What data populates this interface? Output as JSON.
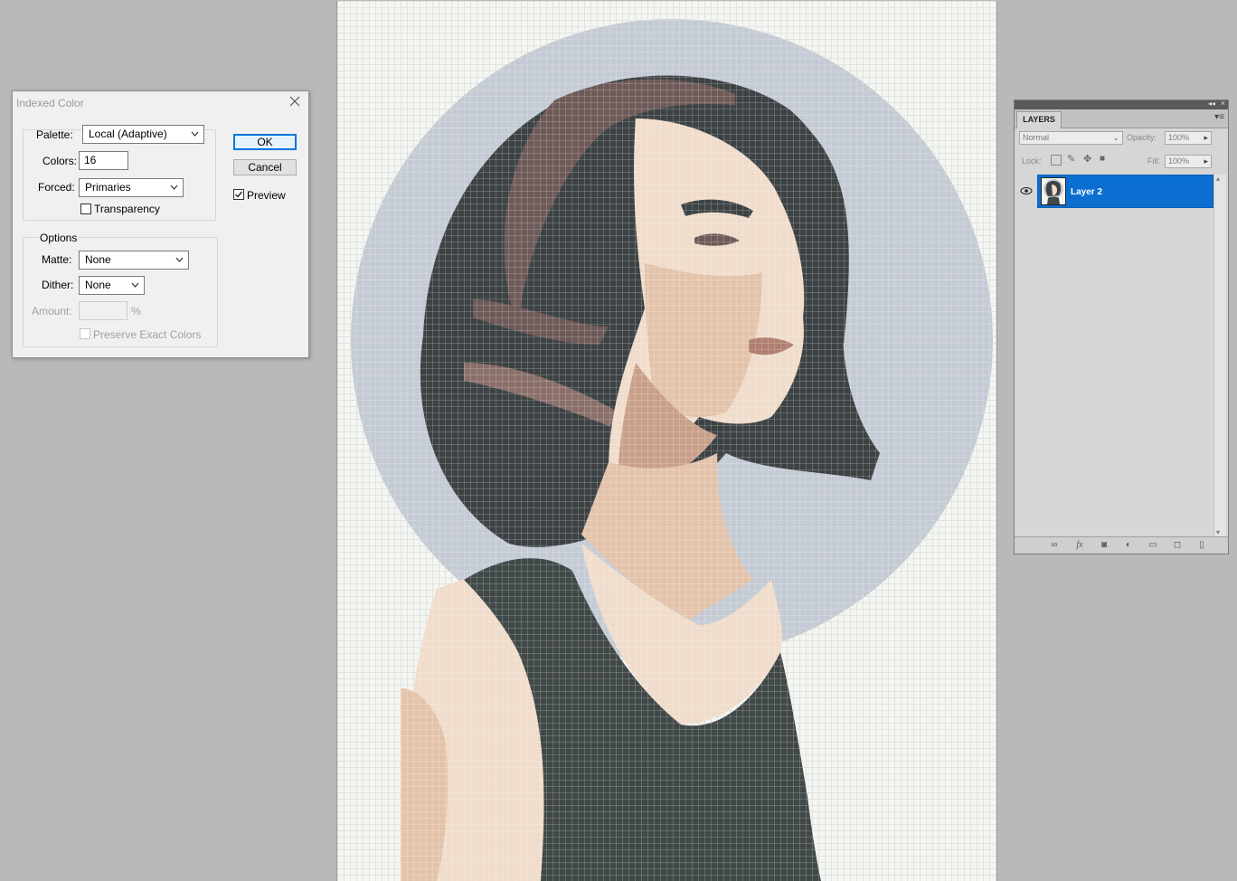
{
  "dialog": {
    "title": "Indexed Color",
    "palette_label": "Palette:",
    "palette_value": "Local (Adaptive)",
    "colors_label": "Colors:",
    "colors_value": "16",
    "forced_label": "Forced:",
    "forced_value": "Primaries",
    "transparency_label": "Transparency",
    "transparency_checked": false,
    "options_legend": "Options",
    "matte_label": "Matte:",
    "matte_value": "None",
    "dither_label": "Dither:",
    "dither_value": "None",
    "amount_label": "Amount:",
    "amount_value": "",
    "amount_unit": "%",
    "preserve_label": "Preserve Exact Colors",
    "preserve_checked": false,
    "ok_label": "OK",
    "cancel_label": "Cancel",
    "preview_label": "Preview",
    "preview_checked": true
  },
  "layers_panel": {
    "tab_label": "LAYERS",
    "blend_mode": "Normal",
    "opacity_label": "Opacity:",
    "opacity_value": "100%",
    "lock_label": "Lock:",
    "fill_label": "Fill:",
    "fill_value": "100%",
    "layers": [
      {
        "name": "Layer 2",
        "visible": true,
        "selected": true
      }
    ],
    "bottom_icons": [
      "link-icon",
      "fx-icon",
      "mask-icon",
      "adjustment-icon",
      "folder-icon",
      "new-layer-icon",
      "trash-icon"
    ]
  },
  "colors": {
    "canvas_bg": "#f4f6f1",
    "circle": "#c5cbd4",
    "hair_dark": "#3d4345",
    "hair_mid": "#6e5a58",
    "skin_light": "#f0dccb",
    "skin_mid": "#e3c3ab",
    "skin_shadow": "#c8a08a",
    "top": "#414848",
    "selection_blue": "#0a6fd1"
  }
}
